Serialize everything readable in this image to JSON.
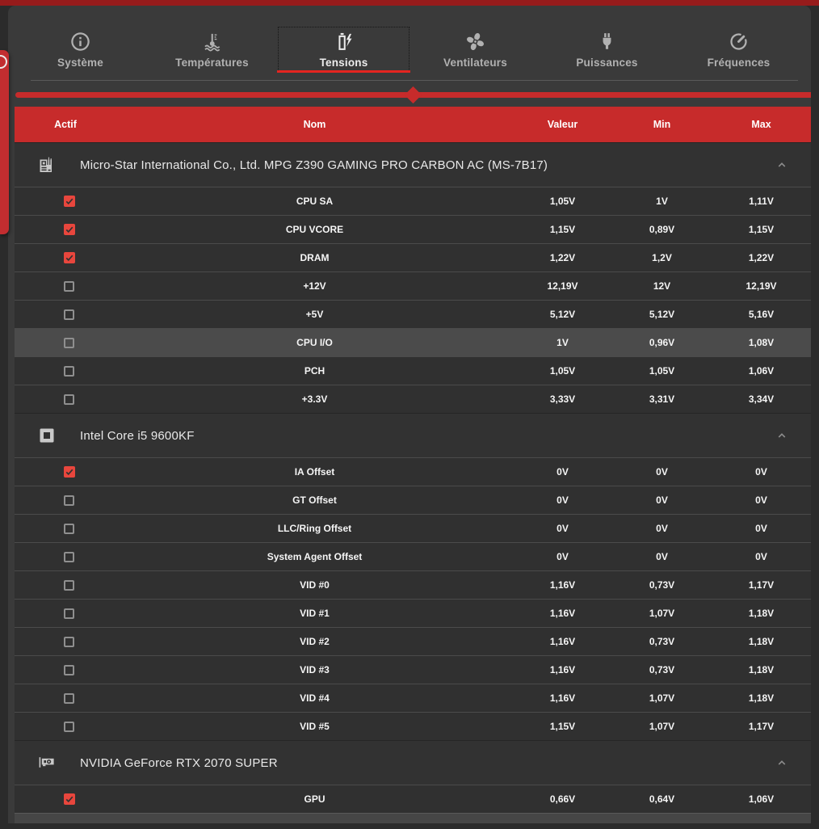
{
  "tabs": [
    {
      "label": "Système",
      "icon": "info-icon",
      "selected": false
    },
    {
      "label": "Températures",
      "icon": "temperature-icon",
      "selected": false
    },
    {
      "label": "Tensions",
      "icon": "voltage-battery-icon",
      "selected": true
    },
    {
      "label": "Ventilateurs",
      "icon": "fan-icon",
      "selected": false
    },
    {
      "label": "Puissances",
      "icon": "power-plug-icon",
      "selected": false
    },
    {
      "label": "Fréquences",
      "icon": "gauge-icon",
      "selected": false
    }
  ],
  "slider": {
    "selected_index": 2,
    "position": "center"
  },
  "columns": {
    "actif": "Actif",
    "nom": "Nom",
    "valeur": "Valeur",
    "min": "Min",
    "max": "Max"
  },
  "sections": [
    {
      "title": "Micro-Star International Co., Ltd. MPG Z390 GAMING PRO CARBON AC (MS-7B17)",
      "icon": "motherboard-icon",
      "rows": [
        {
          "active": true,
          "name": "CPU SA",
          "valeur": "1,05V",
          "min": "1V",
          "max": "1,11V",
          "highlighted": false
        },
        {
          "active": true,
          "name": "CPU VCORE",
          "valeur": "1,15V",
          "min": "0,89V",
          "max": "1,15V",
          "highlighted": false
        },
        {
          "active": true,
          "name": "DRAM",
          "valeur": "1,22V",
          "min": "1,2V",
          "max": "1,22V",
          "highlighted": false
        },
        {
          "active": false,
          "name": "+12V",
          "valeur": "12,19V",
          "min": "12V",
          "max": "12,19V",
          "highlighted": false
        },
        {
          "active": false,
          "name": "+5V",
          "valeur": "5,12V",
          "min": "5,12V",
          "max": "5,16V",
          "highlighted": false
        },
        {
          "active": false,
          "name": "CPU I/O",
          "valeur": "1V",
          "min": "0,96V",
          "max": "1,08V",
          "highlighted": true
        },
        {
          "active": false,
          "name": "PCH",
          "valeur": "1,05V",
          "min": "1,05V",
          "max": "1,06V",
          "highlighted": false
        },
        {
          "active": false,
          "name": "+3.3V",
          "valeur": "3,33V",
          "min": "3,31V",
          "max": "3,34V",
          "highlighted": false
        }
      ]
    },
    {
      "title": "Intel Core i5 9600KF",
      "icon": "cpu-icon",
      "rows": [
        {
          "active": true,
          "name": "IA Offset",
          "valeur": "0V",
          "min": "0V",
          "max": "0V",
          "highlighted": false
        },
        {
          "active": false,
          "name": "GT Offset",
          "valeur": "0V",
          "min": "0V",
          "max": "0V",
          "highlighted": false
        },
        {
          "active": false,
          "name": "LLC/Ring Offset",
          "valeur": "0V",
          "min": "0V",
          "max": "0V",
          "highlighted": false
        },
        {
          "active": false,
          "name": "System Agent Offset",
          "valeur": "0V",
          "min": "0V",
          "max": "0V",
          "highlighted": false
        },
        {
          "active": false,
          "name": "VID #0",
          "valeur": "1,16V",
          "min": "0,73V",
          "max": "1,17V",
          "highlighted": false
        },
        {
          "active": false,
          "name": "VID #1",
          "valeur": "1,16V",
          "min": "1,07V",
          "max": "1,18V",
          "highlighted": false
        },
        {
          "active": false,
          "name": "VID #2",
          "valeur": "1,16V",
          "min": "0,73V",
          "max": "1,18V",
          "highlighted": false
        },
        {
          "active": false,
          "name": "VID #3",
          "valeur": "1,16V",
          "min": "0,73V",
          "max": "1,18V",
          "highlighted": false
        },
        {
          "active": false,
          "name": "VID #4",
          "valeur": "1,16V",
          "min": "1,07V",
          "max": "1,18V",
          "highlighted": false
        },
        {
          "active": false,
          "name": "VID #5",
          "valeur": "1,15V",
          "min": "1,07V",
          "max": "1,17V",
          "highlighted": false
        }
      ]
    },
    {
      "title": "NVIDIA GeForce RTX 2070 SUPER",
      "icon": "gpu-icon",
      "rows": [
        {
          "active": true,
          "name": "GPU",
          "valeur": "0,66V",
          "min": "0,64V",
          "max": "1,06V",
          "highlighted": false
        }
      ]
    }
  ],
  "colors": {
    "accent_red": "#c72b2b",
    "underline_red": "#e42520",
    "checkbox_red": "#e8463d",
    "top_strip_red": "#961b1b",
    "drawer_red": "#c22d30",
    "card_bg": "#3a3a3a",
    "row_bg": "#303030",
    "row_highlight": "#4b4b4b"
  }
}
